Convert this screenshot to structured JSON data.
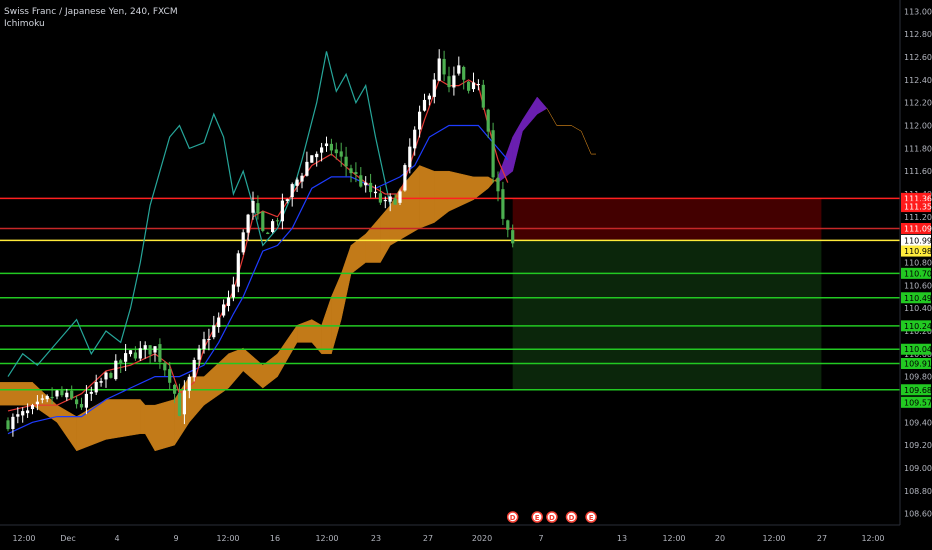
{
  "header": {
    "symbol_title": "Swiss Franc / Japanese Yen, 240, FXCM",
    "indicator_name": "Ichimoku"
  },
  "colors": {
    "background": "#000000",
    "axis_text": "#b2b5be",
    "candle_up": "#ffffff",
    "candle_down": "#4caf50",
    "tenkan": "#e53935",
    "kijun": "#1e3cff",
    "chikou": "#26a69a",
    "cloud_bull": "#c27a18",
    "cloud_bear": "#6a1fb0",
    "stop_zone": "#4a0000",
    "target_zone": "#0c2a0c",
    "red_line": "#ff2020",
    "entry_line": "#ffeb3b",
    "green_line": "#22c922"
  },
  "chart_data": {
    "type": "candlestick",
    "instrument": "CHFJPY",
    "timeframe": "240",
    "ylim": [
      108.5,
      113.1
    ],
    "y_ticks": [
      "113.000",
      "112.800",
      "112.600",
      "112.400",
      "112.200",
      "112.000",
      "111.800",
      "111.600",
      "111.400",
      "111.200",
      "110.800",
      "110.600",
      "110.400",
      "110.200",
      "110.000",
      "109.800",
      "109.400",
      "109.200",
      "109.000",
      "108.800",
      "108.600"
    ],
    "x_ticks": [
      "12:00",
      "Dec",
      "4",
      "9",
      "12:00",
      "16",
      "12:00",
      "23",
      "27",
      "2020",
      "7",
      "13",
      "12:00",
      "20",
      "12:00",
      "27",
      "12:00"
    ],
    "price_labels": [
      {
        "text": "111.362",
        "bg": "#ff1a1a",
        "fg": "#ffffff",
        "value": 111.362
      },
      {
        "text": "111.356",
        "bg": "#ff1a1a",
        "fg": "#ffffff",
        "value": 111.29
      },
      {
        "text": "111.098",
        "bg": "#ff1a1a",
        "fg": "#ffffff",
        "value": 111.098
      },
      {
        "text": "110.994",
        "bg": "#ffffff",
        "fg": "#000000",
        "value": 110.994
      },
      {
        "text": "110.988",
        "bg": "#ffeb3b",
        "fg": "#000000",
        "value": 110.9
      },
      {
        "text": "110.705",
        "bg": "#22c922",
        "fg": "#000000",
        "value": 110.705
      },
      {
        "text": "110.491",
        "bg": "#22c922",
        "fg": "#000000",
        "value": 110.491
      },
      {
        "text": "110.245",
        "bg": "#22c922",
        "fg": "#000000",
        "value": 110.245
      },
      {
        "text": "110.040",
        "bg": "#22c922",
        "fg": "#000000",
        "value": 110.04
      },
      {
        "text": "109.912",
        "bg": "#22c922",
        "fg": "#000000",
        "value": 109.915
      },
      {
        "text": "109.685",
        "bg": "#22c922",
        "fg": "#000000",
        "value": 109.685
      },
      {
        "text": "109.572",
        "bg": "#22c922",
        "fg": "#000000",
        "value": 109.575
      }
    ],
    "horizontal_lines": [
      {
        "value": 111.362,
        "color": "#ff2020",
        "name": "stop-line"
      },
      {
        "value": 111.098,
        "color": "#c62828",
        "name": "red-level-line"
      },
      {
        "value": 110.994,
        "color": "#ffeb3b",
        "name": "entry-line"
      },
      {
        "value": 110.705,
        "color": "#22c922",
        "name": "target-line-1"
      },
      {
        "value": 110.491,
        "color": "#22c922",
        "name": "target-line-2"
      },
      {
        "value": 110.245,
        "color": "#22c922",
        "name": "target-line-3"
      },
      {
        "value": 110.04,
        "color": "#22c922",
        "name": "target-line-4"
      },
      {
        "value": 109.915,
        "color": "#22c922",
        "name": "target-line-5"
      },
      {
        "value": 109.685,
        "color": "#22c922",
        "name": "target-line-6"
      }
    ],
    "position_tool": {
      "entry": 110.994,
      "stop": 111.362,
      "target": 109.685,
      "start_bar": 103,
      "end_bar": 166
    },
    "price_path": [
      [
        0,
        109.4
      ],
      [
        5,
        109.5
      ],
      [
        10,
        109.65
      ],
      [
        15,
        109.55
      ],
      [
        20,
        109.8
      ],
      [
        25,
        110.0
      ],
      [
        30,
        110.05
      ],
      [
        33,
        109.8
      ],
      [
        35,
        109.5
      ],
      [
        38,
        109.9
      ],
      [
        40,
        110.1
      ],
      [
        43,
        110.3
      ],
      [
        46,
        110.6
      ],
      [
        48,
        111.1
      ],
      [
        50,
        111.3
      ],
      [
        52,
        111.05
      ],
      [
        55,
        111.2
      ],
      [
        58,
        111.45
      ],
      [
        62,
        111.75
      ],
      [
        66,
        111.8
      ],
      [
        70,
        111.6
      ],
      [
        73,
        111.45
      ],
      [
        77,
        111.3
      ],
      [
        80,
        111.4
      ],
      [
        82,
        111.8
      ],
      [
        85,
        112.2
      ],
      [
        88,
        112.55
      ],
      [
        90,
        112.3
      ],
      [
        92,
        112.5
      ],
      [
        94,
        112.25
      ],
      [
        96,
        112.4
      ],
      [
        98,
        112.0
      ],
      [
        99,
        111.55
      ],
      [
        100,
        111.4
      ],
      [
        101,
        111.15
      ],
      [
        102,
        111.05
      ],
      [
        103,
        110.95
      ]
    ],
    "cloud": [
      [
        -5,
        109.75,
        109.55
      ],
      [
        5,
        109.75,
        109.55
      ],
      [
        10,
        109.55,
        109.4
      ],
      [
        14,
        109.45,
        109.15
      ],
      [
        20,
        109.6,
        109.25
      ],
      [
        27,
        109.6,
        109.3
      ],
      [
        28,
        109.55,
        109.3
      ],
      [
        30,
        109.55,
        109.15
      ],
      [
        34,
        109.6,
        109.2
      ],
      [
        37,
        109.8,
        109.4
      ],
      [
        40,
        109.8,
        109.55
      ],
      [
        45,
        110.0,
        109.7
      ],
      [
        48,
        110.05,
        109.85
      ],
      [
        52,
        109.9,
        109.7
      ],
      [
        55,
        110.0,
        109.8
      ],
      [
        59,
        110.25,
        110.1
      ],
      [
        62,
        110.3,
        110.1
      ],
      [
        64,
        110.25,
        110.0
      ],
      [
        66,
        110.5,
        110.0
      ],
      [
        68,
        110.7,
        110.3
      ],
      [
        70,
        110.95,
        110.7
      ],
      [
        73,
        111.05,
        110.8
      ],
      [
        76,
        111.2,
        110.8
      ],
      [
        78,
        111.3,
        110.95
      ],
      [
        80,
        111.45,
        111.0
      ],
      [
        84,
        111.65,
        111.1
      ],
      [
        87,
        111.6,
        111.15
      ],
      [
        90,
        111.6,
        111.25
      ],
      [
        95,
        111.55,
        111.35
      ],
      [
        98,
        111.55,
        111.45
      ],
      [
        100,
        111.5,
        111.55
      ],
      [
        103,
        111.6,
        111.9
      ],
      [
        105,
        111.95,
        112.05
      ],
      [
        108,
        112.1,
        112.25
      ],
      [
        110,
        112.15,
        112.15
      ],
      [
        112,
        112.0,
        112.0
      ],
      [
        115,
        112.0,
        112.0
      ],
      [
        117,
        111.95,
        111.95
      ],
      [
        119,
        111.75,
        111.75
      ],
      [
        120,
        111.75,
        111.75
      ]
    ],
    "tenkan": [
      [
        0,
        109.5
      ],
      [
        5,
        109.55
      ],
      [
        10,
        109.55
      ],
      [
        15,
        109.65
      ],
      [
        20,
        109.85
      ],
      [
        25,
        109.9
      ],
      [
        30,
        110.0
      ],
      [
        33,
        109.9
      ],
      [
        35,
        109.65
      ],
      [
        38,
        109.75
      ],
      [
        40,
        110.05
      ],
      [
        43,
        110.3
      ],
      [
        46,
        110.55
      ],
      [
        48,
        110.85
      ],
      [
        50,
        111.2
      ],
      [
        52,
        111.25
      ],
      [
        55,
        111.2
      ],
      [
        58,
        111.4
      ],
      [
        62,
        111.65
      ],
      [
        66,
        111.75
      ],
      [
        70,
        111.6
      ],
      [
        73,
        111.5
      ],
      [
        77,
        111.4
      ],
      [
        80,
        111.4
      ],
      [
        82,
        111.65
      ],
      [
        85,
        112.05
      ],
      [
        88,
        112.4
      ],
      [
        90,
        112.35
      ],
      [
        92,
        112.35
      ],
      [
        94,
        112.4
      ],
      [
        96,
        112.35
      ],
      [
        98,
        112.0
      ],
      [
        100,
        111.7
      ],
      [
        102,
        111.5
      ]
    ],
    "kijun": [
      [
        0,
        109.3
      ],
      [
        5,
        109.4
      ],
      [
        10,
        109.45
      ],
      [
        15,
        109.45
      ],
      [
        20,
        109.6
      ],
      [
        25,
        109.7
      ],
      [
        30,
        109.8
      ],
      [
        35,
        109.8
      ],
      [
        40,
        109.9
      ],
      [
        43,
        110.1
      ],
      [
        46,
        110.35
      ],
      [
        48,
        110.5
      ],
      [
        50,
        110.7
      ],
      [
        52,
        110.9
      ],
      [
        55,
        110.95
      ],
      [
        58,
        111.1
      ],
      [
        62,
        111.45
      ],
      [
        66,
        111.55
      ],
      [
        70,
        111.55
      ],
      [
        75,
        111.45
      ],
      [
        80,
        111.55
      ],
      [
        83,
        111.65
      ],
      [
        86,
        111.9
      ],
      [
        90,
        112.0
      ],
      [
        94,
        112.0
      ],
      [
        96,
        112.0
      ],
      [
        98,
        111.9
      ],
      [
        100,
        111.8
      ],
      [
        102,
        111.7
      ]
    ],
    "chikou": [
      [
        0,
        109.8
      ],
      [
        3,
        110.0
      ],
      [
        6,
        109.9
      ],
      [
        10,
        110.1
      ],
      [
        14,
        110.3
      ],
      [
        17,
        110.0
      ],
      [
        20,
        110.2
      ],
      [
        23,
        110.1
      ],
      [
        25,
        110.4
      ],
      [
        27,
        110.8
      ],
      [
        29,
        111.3
      ],
      [
        31,
        111.6
      ],
      [
        33,
        111.9
      ],
      [
        35,
        112.0
      ],
      [
        37,
        111.8
      ],
      [
        40,
        111.85
      ],
      [
        42,
        112.1
      ],
      [
        44,
        111.9
      ],
      [
        46,
        111.4
      ],
      [
        48,
        111.6
      ],
      [
        50,
        111.3
      ],
      [
        52,
        110.95
      ],
      [
        55,
        111.1
      ],
      [
        58,
        111.4
      ],
      [
        60,
        111.7
      ],
      [
        63,
        112.2
      ],
      [
        65,
        112.65
      ],
      [
        67,
        112.3
      ],
      [
        69,
        112.45
      ],
      [
        71,
        112.2
      ],
      [
        73,
        112.35
      ],
      [
        75,
        111.9
      ],
      [
        77,
        111.5
      ],
      [
        78,
        111.3
      ]
    ],
    "event_markers": [
      {
        "label": "D",
        "bar": 103
      },
      {
        "label": "E",
        "bar": 108
      },
      {
        "label": "D",
        "bar": 111
      },
      {
        "label": "D",
        "bar": 115
      },
      {
        "label": "E",
        "bar": 119
      }
    ]
  }
}
